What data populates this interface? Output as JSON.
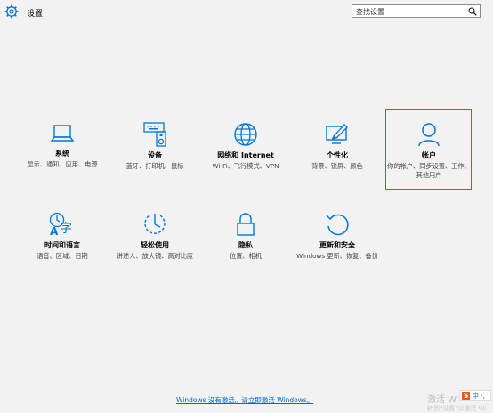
{
  "header": {
    "title": "设置",
    "search_placeholder": "查找设置"
  },
  "tiles": [
    {
      "title": "系统",
      "desc": "显示、通知、应用、电源",
      "icon": "laptop-icon"
    },
    {
      "title": "设备",
      "desc": "蓝牙、打印机、鼠标",
      "icon": "devices-icon"
    },
    {
      "title": "网络和 Internet",
      "desc": "Wi-Fi、飞行模式、VPN",
      "icon": "globe-icon"
    },
    {
      "title": "个性化",
      "desc": "背景、锁屏、颜色",
      "icon": "paint-icon"
    },
    {
      "title": "帐户",
      "desc": "你的帐户、同步设置、工作、其他用户",
      "icon": "person-icon"
    },
    {
      "title": "时间和语言",
      "desc": "语音、区域、日期",
      "icon": "time-language-icon"
    },
    {
      "title": "轻松使用",
      "desc": "讲述人、放大镜、高对比度",
      "icon": "ease-of-access-icon"
    },
    {
      "title": "隐私",
      "desc": "位置、相机",
      "icon": "lock-icon"
    },
    {
      "title": "更新和安全",
      "desc": "Windows 更新、恢复、备份",
      "icon": "update-icon"
    }
  ],
  "footer": {
    "activate_link": "Windows 没有激活。请立即激活 Windows。"
  },
  "watermark": {
    "line1": "激活 W",
    "line2": "转到\"设置\"以激活 Wi"
  },
  "ime": {
    "badge": "S",
    "label": "中 ·,",
    "text": "中"
  },
  "colors": {
    "accent": "#0078d7",
    "selected_border": "#e03b3b"
  }
}
